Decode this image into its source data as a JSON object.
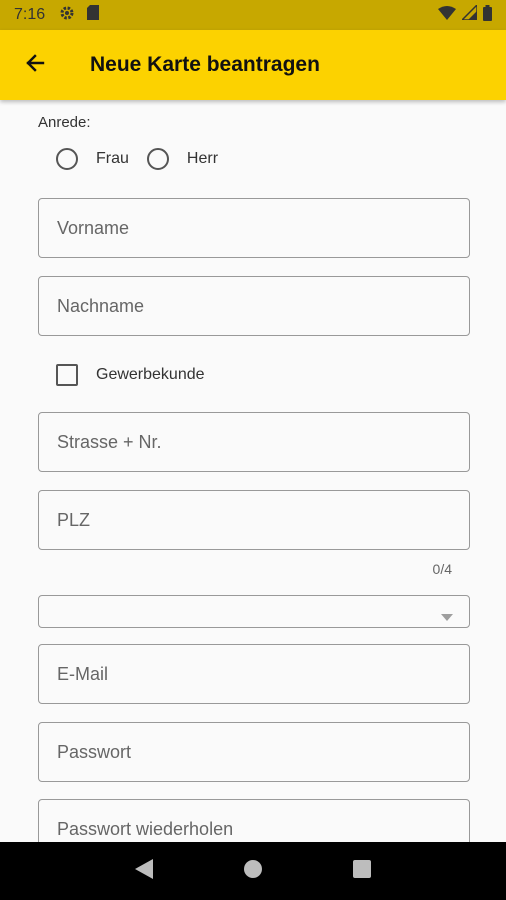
{
  "status_bar": {
    "time": "7:16",
    "icons": [
      "gear-icon",
      "sd-card-icon",
      "wifi-icon",
      "signal-icon",
      "battery-icon"
    ]
  },
  "app_bar": {
    "back_icon": "arrow-left-icon",
    "title": "Neue Karte beantragen",
    "background": "#fcd200"
  },
  "form": {
    "anrede_label": "Anrede:",
    "anrede_options": [
      {
        "label": "Frau",
        "selected": false
      },
      {
        "label": "Herr",
        "selected": false
      }
    ],
    "vorname": {
      "placeholder": "Vorname",
      "value": ""
    },
    "nachname": {
      "placeholder": "Nachname",
      "value": ""
    },
    "gewerbekunde": {
      "label": "Gewerbekunde",
      "checked": false
    },
    "strasse": {
      "placeholder": "Strasse + Nr.",
      "value": ""
    },
    "plz": {
      "placeholder": "PLZ",
      "value": "",
      "counter": "0/4"
    },
    "ort_dropdown": {
      "selected": ""
    },
    "email": {
      "placeholder": "E-Mail",
      "value": ""
    },
    "passwort": {
      "placeholder": "Passwort",
      "value": ""
    },
    "passwort_wiederholen": {
      "placeholder": "Passwort wiederholen",
      "value": ""
    }
  },
  "nav_bar": {
    "buttons": [
      "back-triangle-icon",
      "home-circle-icon",
      "recents-square-icon"
    ]
  }
}
